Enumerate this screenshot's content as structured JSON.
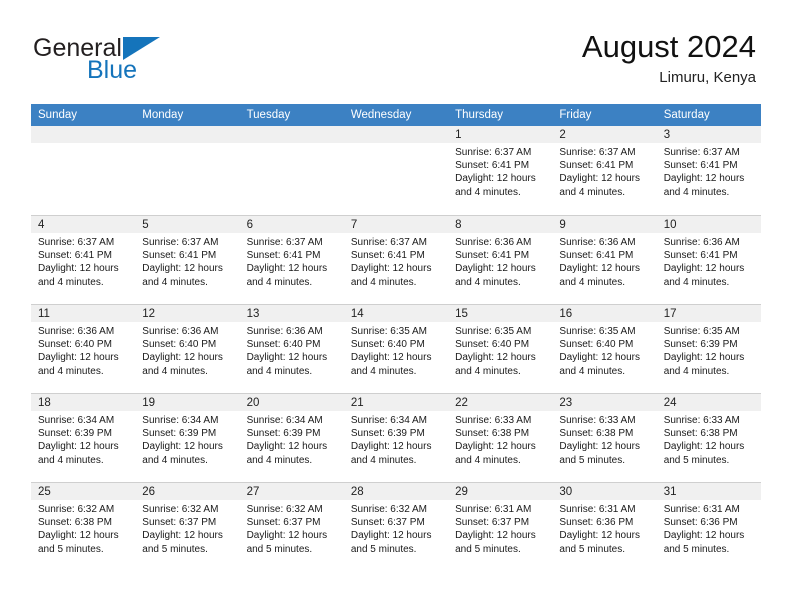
{
  "brand": {
    "name_part1": "General",
    "name_part2": "Blue",
    "logo_icon": "triangle-logo-icon",
    "accent_color": "#1574bb"
  },
  "header": {
    "title": "August 2024",
    "subtitle": "Limuru, Kenya"
  },
  "calendar": {
    "header_bg": "#3c81c3",
    "daynum_band_bg": "#f0f0f0",
    "weekday_headers": [
      "Sunday",
      "Monday",
      "Tuesday",
      "Wednesday",
      "Thursday",
      "Friday",
      "Saturday"
    ],
    "weeks": [
      [
        {
          "day": "",
          "sunrise": "",
          "sunset": "",
          "daylight": ""
        },
        {
          "day": "",
          "sunrise": "",
          "sunset": "",
          "daylight": ""
        },
        {
          "day": "",
          "sunrise": "",
          "sunset": "",
          "daylight": ""
        },
        {
          "day": "",
          "sunrise": "",
          "sunset": "",
          "daylight": ""
        },
        {
          "day": "1",
          "sunrise": "Sunrise: 6:37 AM",
          "sunset": "Sunset: 6:41 PM",
          "daylight": "Daylight: 12 hours and 4 minutes."
        },
        {
          "day": "2",
          "sunrise": "Sunrise: 6:37 AM",
          "sunset": "Sunset: 6:41 PM",
          "daylight": "Daylight: 12 hours and 4 minutes."
        },
        {
          "day": "3",
          "sunrise": "Sunrise: 6:37 AM",
          "sunset": "Sunset: 6:41 PM",
          "daylight": "Daylight: 12 hours and 4 minutes."
        }
      ],
      [
        {
          "day": "4",
          "sunrise": "Sunrise: 6:37 AM",
          "sunset": "Sunset: 6:41 PM",
          "daylight": "Daylight: 12 hours and 4 minutes."
        },
        {
          "day": "5",
          "sunrise": "Sunrise: 6:37 AM",
          "sunset": "Sunset: 6:41 PM",
          "daylight": "Daylight: 12 hours and 4 minutes."
        },
        {
          "day": "6",
          "sunrise": "Sunrise: 6:37 AM",
          "sunset": "Sunset: 6:41 PM",
          "daylight": "Daylight: 12 hours and 4 minutes."
        },
        {
          "day": "7",
          "sunrise": "Sunrise: 6:37 AM",
          "sunset": "Sunset: 6:41 PM",
          "daylight": "Daylight: 12 hours and 4 minutes."
        },
        {
          "day": "8",
          "sunrise": "Sunrise: 6:36 AM",
          "sunset": "Sunset: 6:41 PM",
          "daylight": "Daylight: 12 hours and 4 minutes."
        },
        {
          "day": "9",
          "sunrise": "Sunrise: 6:36 AM",
          "sunset": "Sunset: 6:41 PM",
          "daylight": "Daylight: 12 hours and 4 minutes."
        },
        {
          "day": "10",
          "sunrise": "Sunrise: 6:36 AM",
          "sunset": "Sunset: 6:41 PM",
          "daylight": "Daylight: 12 hours and 4 minutes."
        }
      ],
      [
        {
          "day": "11",
          "sunrise": "Sunrise: 6:36 AM",
          "sunset": "Sunset: 6:40 PM",
          "daylight": "Daylight: 12 hours and 4 minutes."
        },
        {
          "day": "12",
          "sunrise": "Sunrise: 6:36 AM",
          "sunset": "Sunset: 6:40 PM",
          "daylight": "Daylight: 12 hours and 4 minutes."
        },
        {
          "day": "13",
          "sunrise": "Sunrise: 6:36 AM",
          "sunset": "Sunset: 6:40 PM",
          "daylight": "Daylight: 12 hours and 4 minutes."
        },
        {
          "day": "14",
          "sunrise": "Sunrise: 6:35 AM",
          "sunset": "Sunset: 6:40 PM",
          "daylight": "Daylight: 12 hours and 4 minutes."
        },
        {
          "day": "15",
          "sunrise": "Sunrise: 6:35 AM",
          "sunset": "Sunset: 6:40 PM",
          "daylight": "Daylight: 12 hours and 4 minutes."
        },
        {
          "day": "16",
          "sunrise": "Sunrise: 6:35 AM",
          "sunset": "Sunset: 6:40 PM",
          "daylight": "Daylight: 12 hours and 4 minutes."
        },
        {
          "day": "17",
          "sunrise": "Sunrise: 6:35 AM",
          "sunset": "Sunset: 6:39 PM",
          "daylight": "Daylight: 12 hours and 4 minutes."
        }
      ],
      [
        {
          "day": "18",
          "sunrise": "Sunrise: 6:34 AM",
          "sunset": "Sunset: 6:39 PM",
          "daylight": "Daylight: 12 hours and 4 minutes."
        },
        {
          "day": "19",
          "sunrise": "Sunrise: 6:34 AM",
          "sunset": "Sunset: 6:39 PM",
          "daylight": "Daylight: 12 hours and 4 minutes."
        },
        {
          "day": "20",
          "sunrise": "Sunrise: 6:34 AM",
          "sunset": "Sunset: 6:39 PM",
          "daylight": "Daylight: 12 hours and 4 minutes."
        },
        {
          "day": "21",
          "sunrise": "Sunrise: 6:34 AM",
          "sunset": "Sunset: 6:39 PM",
          "daylight": "Daylight: 12 hours and 4 minutes."
        },
        {
          "day": "22",
          "sunrise": "Sunrise: 6:33 AM",
          "sunset": "Sunset: 6:38 PM",
          "daylight": "Daylight: 12 hours and 4 minutes."
        },
        {
          "day": "23",
          "sunrise": "Sunrise: 6:33 AM",
          "sunset": "Sunset: 6:38 PM",
          "daylight": "Daylight: 12 hours and 5 minutes."
        },
        {
          "day": "24",
          "sunrise": "Sunrise: 6:33 AM",
          "sunset": "Sunset: 6:38 PM",
          "daylight": "Daylight: 12 hours and 5 minutes."
        }
      ],
      [
        {
          "day": "25",
          "sunrise": "Sunrise: 6:32 AM",
          "sunset": "Sunset: 6:38 PM",
          "daylight": "Daylight: 12 hours and 5 minutes."
        },
        {
          "day": "26",
          "sunrise": "Sunrise: 6:32 AM",
          "sunset": "Sunset: 6:37 PM",
          "daylight": "Daylight: 12 hours and 5 minutes."
        },
        {
          "day": "27",
          "sunrise": "Sunrise: 6:32 AM",
          "sunset": "Sunset: 6:37 PM",
          "daylight": "Daylight: 12 hours and 5 minutes."
        },
        {
          "day": "28",
          "sunrise": "Sunrise: 6:32 AM",
          "sunset": "Sunset: 6:37 PM",
          "daylight": "Daylight: 12 hours and 5 minutes."
        },
        {
          "day": "29",
          "sunrise": "Sunrise: 6:31 AM",
          "sunset": "Sunset: 6:37 PM",
          "daylight": "Daylight: 12 hours and 5 minutes."
        },
        {
          "day": "30",
          "sunrise": "Sunrise: 6:31 AM",
          "sunset": "Sunset: 6:36 PM",
          "daylight": "Daylight: 12 hours and 5 minutes."
        },
        {
          "day": "31",
          "sunrise": "Sunrise: 6:31 AM",
          "sunset": "Sunset: 6:36 PM",
          "daylight": "Daylight: 12 hours and 5 minutes."
        }
      ]
    ]
  }
}
